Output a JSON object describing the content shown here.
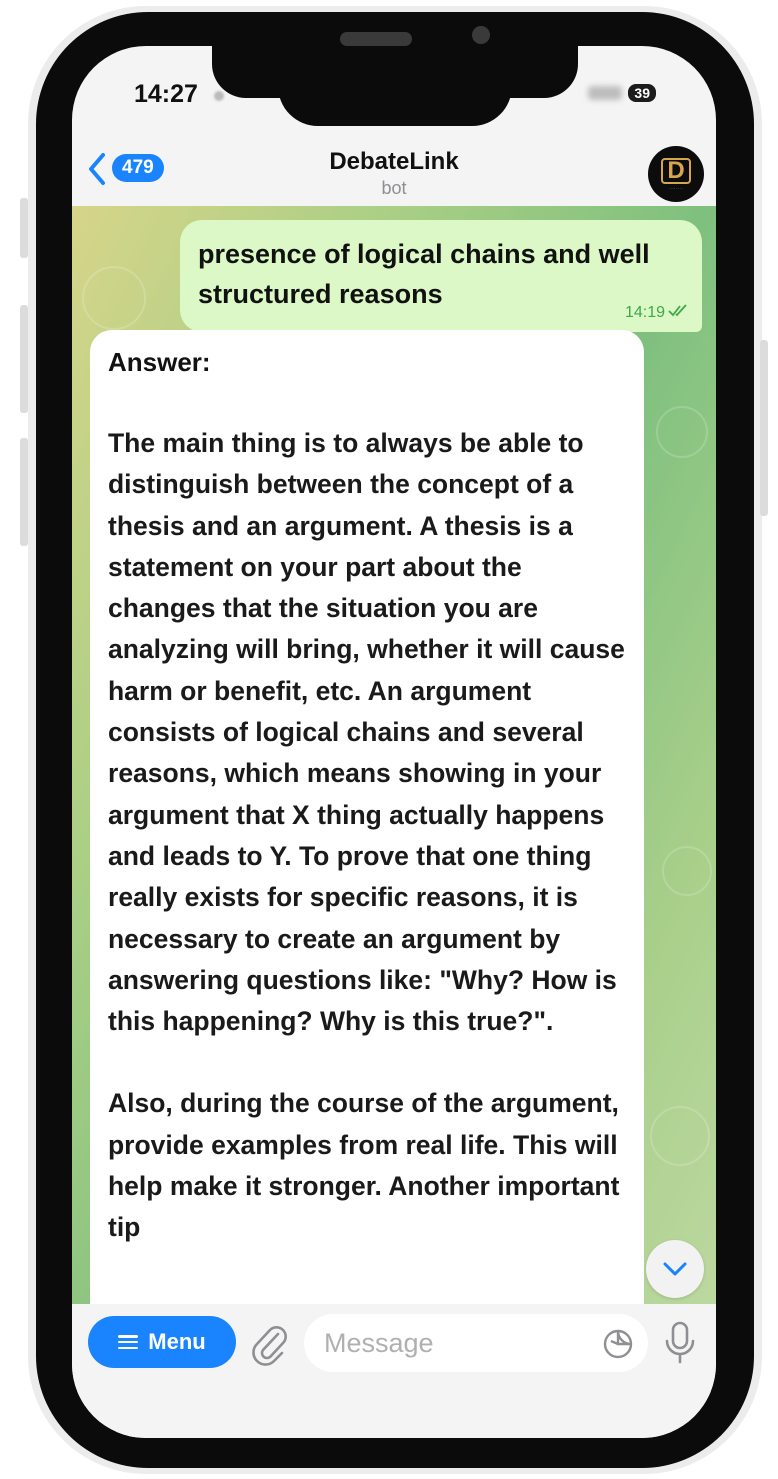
{
  "status_bar": {
    "time": "14:27",
    "battery": "39"
  },
  "header": {
    "back_count": "479",
    "title": "DebateLink",
    "subtitle": "bot"
  },
  "messages": {
    "outgoing": {
      "text": "presence of logical chains and well structured reasons",
      "time": "14:19"
    },
    "incoming": {
      "title": "Answer:",
      "paragraph1": "The main thing is to always be able to distinguish between the concept of a thesis and an argument. A thesis is a statement on your part about the changes that the situation you are analyzing will bring, whether it will cause harm or benefit, etc. An argument consists of logical chains and several reasons, which means showing in your argument that X thing actually happens and leads to Y. To prove that one thing really exists for specific reasons, it is necessary to create an argument by answering questions like: \"Why? How is this happening? Why is this true?\".",
      "paragraph2": "Also, during the course of the argument, provide examples from real life. This will help make it stronger. Another important tip"
    }
  },
  "input": {
    "menu_label": "Menu",
    "placeholder": "Message"
  },
  "colors": {
    "accent": "#1a84ff",
    "outgoing_bubble": "#dbf8c6",
    "check_green": "#3fa84a"
  },
  "icons": [
    "back-chevron-icon",
    "avatar-logo",
    "double-check-icon",
    "chevron-down-icon",
    "menu-icon",
    "paperclip-icon",
    "sticker-icon",
    "microphone-icon"
  ]
}
